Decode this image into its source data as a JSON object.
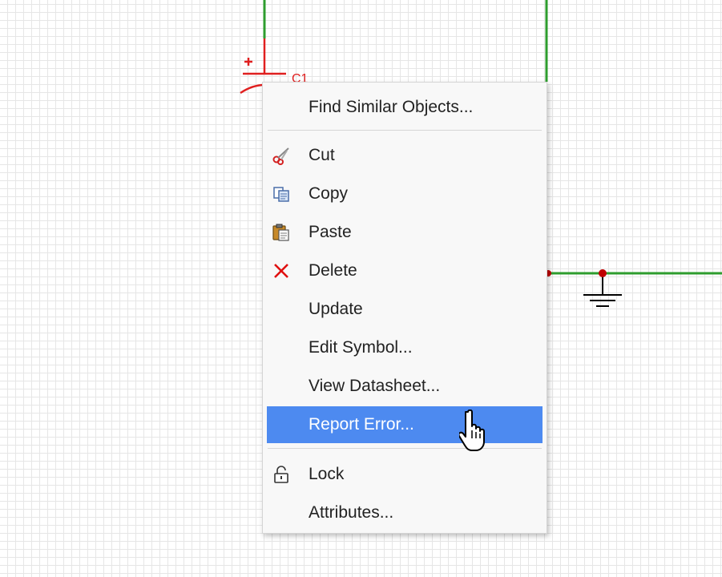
{
  "schematic": {
    "designator": "C1",
    "wire_color": "#2e9d2e",
    "component_color": "#e02020",
    "junction_color": "#c00000"
  },
  "menu": {
    "highlight_color": "#4d8af0",
    "items": [
      {
        "label": "Find Similar Objects...",
        "icon": null
      },
      {
        "label": "Cut",
        "icon": "scissors-icon"
      },
      {
        "label": "Copy",
        "icon": "copy-icon"
      },
      {
        "label": "Paste",
        "icon": "paste-icon"
      },
      {
        "label": "Delete",
        "icon": "delete-x-icon"
      },
      {
        "label": "Update",
        "icon": null
      },
      {
        "label": "Edit Symbol...",
        "icon": null
      },
      {
        "label": "View Datasheet...",
        "icon": null
      },
      {
        "label": "Report Error...",
        "icon": null,
        "highlighted": true
      },
      {
        "label": "Lock",
        "icon": "padlock-icon"
      },
      {
        "label": "Attributes...",
        "icon": null
      }
    ]
  },
  "cursor": "hand-pointer-icon"
}
